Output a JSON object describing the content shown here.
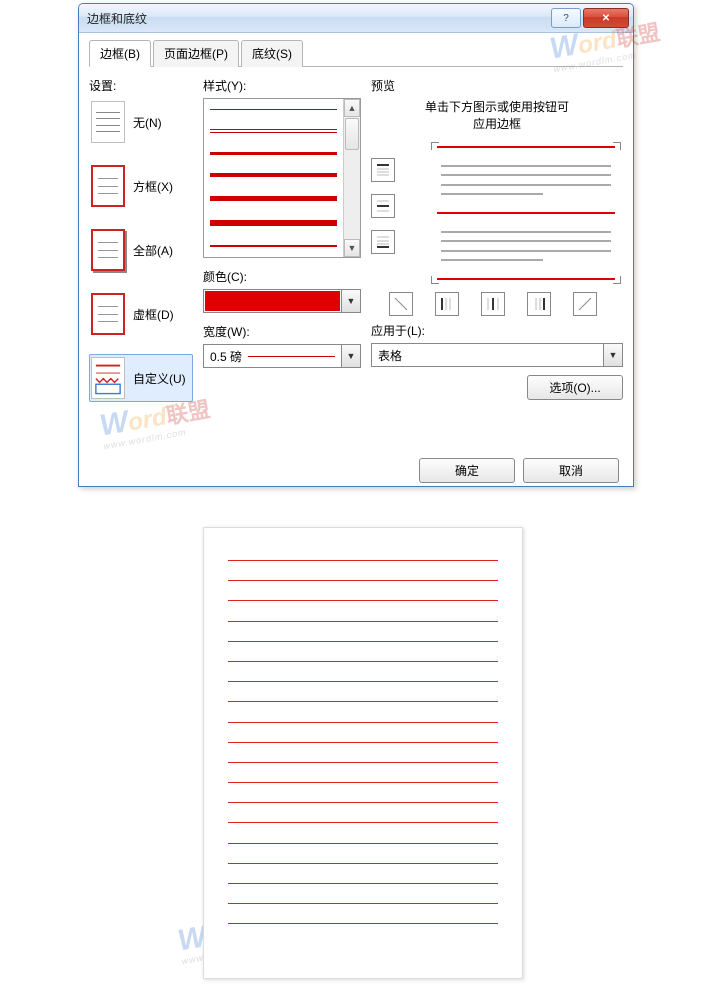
{
  "dialog": {
    "title": "边框和底纹",
    "tabs": [
      {
        "label": "边框(B)",
        "active": true
      },
      {
        "label": "页面边框(P)",
        "active": false
      },
      {
        "label": "底纹(S)",
        "active": false
      }
    ],
    "settings": {
      "label": "设置:",
      "options": [
        {
          "key": "none",
          "label": "无(N)"
        },
        {
          "key": "box",
          "label": "方框(X)"
        },
        {
          "key": "all",
          "label": "全部(A)"
        },
        {
          "key": "grid",
          "label": "虚框(D)"
        },
        {
          "key": "custom",
          "label": "自定义(U)",
          "selected": true
        }
      ]
    },
    "style": {
      "label": "样式(Y):"
    },
    "color": {
      "label": "颜色(C):",
      "value_hex": "#e00000"
    },
    "width": {
      "label": "宽度(W):",
      "value": "0.5 磅"
    },
    "preview": {
      "label": "预览",
      "hint_line1": "单击下方图示或使用按钮可",
      "hint_line2": "应用边框"
    },
    "apply": {
      "label": "应用于(L):",
      "value": "表格"
    },
    "options_btn": "选项(O)...",
    "ok": "确定",
    "cancel": "取消"
  },
  "watermark": {
    "brand_w": "W",
    "brand_ord": "ord",
    "brand_cn": "联盟",
    "url": "www.wordlm.com"
  }
}
